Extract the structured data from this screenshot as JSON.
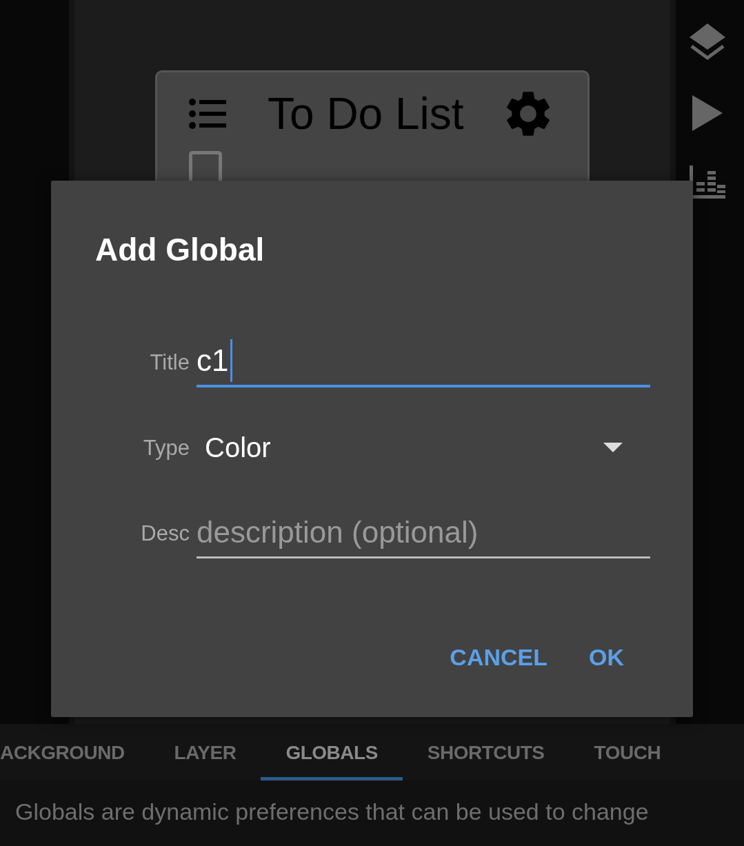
{
  "editor": {
    "widget": {
      "title": "To Do List",
      "items": [
        {
          "checked": false
        }
      ]
    }
  },
  "dialog": {
    "title": "Add Global",
    "fields": [
      {
        "kind": "text",
        "label": "Title",
        "value": "c1",
        "focused": true
      },
      {
        "kind": "dropdown",
        "label": "Type",
        "value": "Color"
      },
      {
        "kind": "text",
        "label": "Desc",
        "placeholder": "description (optional)",
        "focused": false
      }
    ],
    "buttons": [
      "CANCEL",
      "OK"
    ]
  },
  "tabs": [
    {
      "label": "ACKGROUND",
      "selected": false
    },
    {
      "label": "LAYER",
      "selected": false
    },
    {
      "label": "GLOBALS",
      "selected": true
    },
    {
      "label": "SHORTCUTS",
      "selected": false
    },
    {
      "label": "TOUCH",
      "selected": false
    }
  ],
  "description": "Globals are dynamic preferences that can be used to change"
}
